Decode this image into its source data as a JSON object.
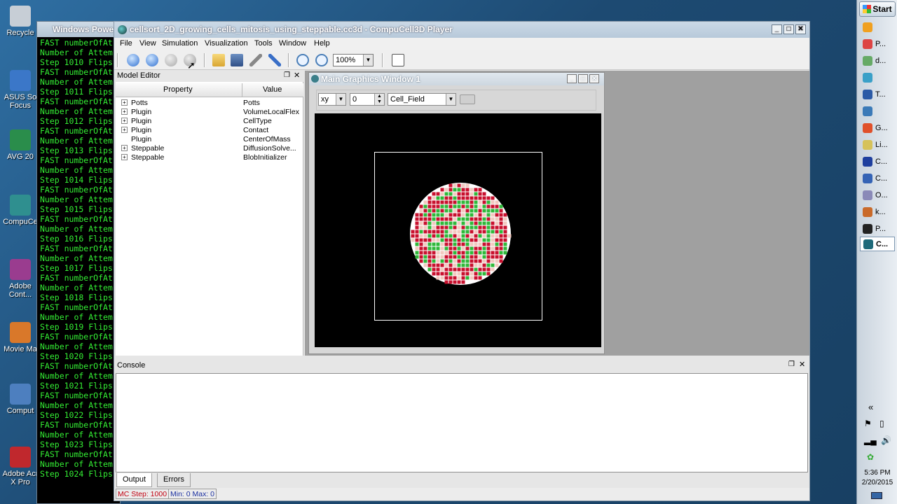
{
  "desktop": {
    "icons": [
      {
        "label": "Recycle",
        "color": "#c7ced6"
      },
      {
        "label": "ASUS So\nFocus",
        "color": "#3b77c8"
      },
      {
        "label": "AVG 20",
        "color": "#2a8d4b"
      },
      {
        "label": "CompuCe",
        "color": "#2f8f8f"
      },
      {
        "label": "Adobe\nCont...",
        "color": "#9a3c8f"
      },
      {
        "label": "Movie Ma",
        "color": "#d9782a"
      },
      {
        "label": "Comput",
        "color": "#4d7fbf"
      },
      {
        "label": "Adobe Acr\nX Pro",
        "color": "#c0282d"
      }
    ]
  },
  "powershell": {
    "title": "Windows Powe",
    "lines": [
      "FAST numberOfAt",
      "Number of Attem",
      "Step 1010 Flips",
      "FAST numberOfAt",
      "Number of Attem",
      "Step 1011 Flips",
      "FAST numberOfAt",
      "Number of Attem",
      "Step 1012 Flips",
      "FAST numberOfAt",
      "Number of Attem",
      "Step 1013 Flips",
      "FAST numberOfAt",
      "Number of Attem",
      "Step 1014 Flips",
      "FAST numberOfAt",
      "Number of Attem",
      "Step 1015 Flips",
      "FAST numberOfAt",
      "Number of Attem",
      "Step 1016 Flips",
      "FAST numberOfAt",
      "Number of Attem",
      "Step 1017 Flips",
      "FAST numberOfAt",
      "Number of Attem",
      "Step 1018 Flips",
      "FAST numberOfAt",
      "Number of Attem",
      "Step 1019 Flips",
      "FAST numberOfAt",
      "Number of Attem",
      "Step 1020 Flips",
      "FAST numberOfAt",
      "Number of Attem",
      "Step 1021 Flips",
      "FAST numberOfAt",
      "Number of Attem",
      "Step 1022 Flips",
      "FAST numberOfAt",
      "Number of Attem",
      "Step 1023 Flips",
      "FAST numberOfAt",
      "Number of Attem",
      "Step 1024 Flips"
    ]
  },
  "window": {
    "title": "cellsort_2D_growing_cells_mitosis_using_steppable.cc3d - CompuCell3D Player"
  },
  "menu": [
    "File",
    "View",
    "Simulation",
    "Visualization",
    "Tools",
    "Window",
    "Help"
  ],
  "toolbar": {
    "zoom": "100%"
  },
  "model_editor": {
    "title": "Model Editor",
    "col_property": "Property",
    "col_value": "Value",
    "rows": [
      {
        "property": "Potts",
        "value": "Potts",
        "expandable": true
      },
      {
        "property": "Plugin",
        "value": "VolumeLocalFlex",
        "expandable": true
      },
      {
        "property": "Plugin",
        "value": "CellType",
        "expandable": true
      },
      {
        "property": "Plugin",
        "value": "Contact",
        "expandable": true
      },
      {
        "property": "Plugin",
        "value": "CenterOfMass",
        "expandable": false
      },
      {
        "property": "Steppable",
        "value": "DiffusionSolve...",
        "expandable": true
      },
      {
        "property": "Steppable",
        "value": "BlobInitializer",
        "expandable": true
      }
    ]
  },
  "graphics": {
    "title": "Main Graphics Window 1",
    "plane": "xy",
    "position": "0",
    "field": "Cell_Field",
    "colors": {
      "red": "#c8102e",
      "pink": "#f2c9c0",
      "green": "#2fb83a",
      "border": "#ffffff"
    }
  },
  "console": {
    "title": "Console",
    "tabs": [
      "Output",
      "Errors"
    ]
  },
  "status": {
    "mc_step": "MC Step: 1000",
    "minmax": "Min: 0 Max: 0"
  },
  "taskbar": {
    "start": "Start",
    "items": [
      {
        "label": "",
        "color": "#f0a020"
      },
      {
        "label": "P...",
        "color": "#d44"
      },
      {
        "label": "d...",
        "color": "#6a6"
      },
      {
        "label": "",
        "color": "#3aa0c8"
      },
      {
        "label": "T...",
        "color": "#2b5aa6"
      },
      {
        "label": "",
        "color": "#3b7ab8"
      },
      {
        "label": "G...",
        "color": "#e0502a"
      },
      {
        "label": "Li...",
        "color": "#d6c25a"
      },
      {
        "label": "C...",
        "color": "#1f3f9e"
      },
      {
        "label": "C...",
        "color": "#3463b5"
      },
      {
        "label": "O...",
        "color": "#8a8ab8"
      },
      {
        "label": "k...",
        "color": "#c96a2a"
      },
      {
        "label": "P...",
        "color": "#222"
      },
      {
        "label": "C...",
        "color": "#1f6a7a"
      }
    ],
    "time": "5:36 PM",
    "date": "2/20/2015"
  }
}
